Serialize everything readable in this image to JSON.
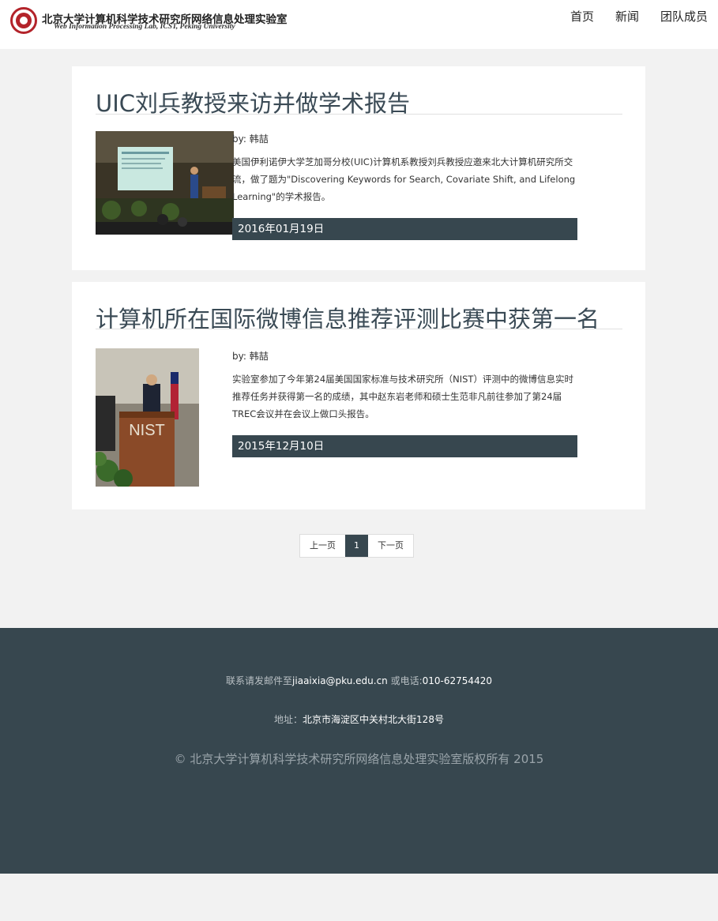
{
  "header": {
    "lab_name_cn": "北京大学计算机科学技术研究所网络信息处理实验室",
    "lab_name_en": "Web Information Processing Lab, ICST, Peking University",
    "nav": [
      "首页",
      "新闻",
      "团队成员"
    ]
  },
  "articles": [
    {
      "title": "UIC刘兵教授来访并做学术报告",
      "author": "by: 韩喆",
      "summary": "美国伊利诺伊大学芝加哥分校(UIC)计算机系教授刘兵教授应邀来北大计算机研究所交流，做了题为\"Discovering Keywords for Search, Covariate Shift, and Lifelong Learning\"的学术报告。",
      "date": "2016年01月19日"
    },
    {
      "title": "计算机所在国际微博信息推荐评测比赛中获第一名",
      "author": "by: 韩喆",
      "summary": "实验室参加了今年第24届美国国家标准与技术研究所（NIST）评测中的微博信息实时推荐任务并获得第一名的成绩，其中赵东岩老师和硕士生范非凡前往参加了第24届TREC会议并在会议上做口头报告。",
      "date": "2015年12月10日"
    }
  ],
  "pagination": {
    "prev": "上一页",
    "current": "1",
    "next": "下一页"
  },
  "footer": {
    "contact_prefix": "联系请发邮件至",
    "email": "jiaaixia@pku.edu.cn",
    "contact_mid": " 或电话:",
    "phone": "010-62754420",
    "address_label": "地址：",
    "address": "北京市海淀区中关村北大街128号",
    "copyright": "© 北京大学计算机科学技术研究所网络信息处理实验室版权所有 2015"
  },
  "colors": {
    "accent": "#37474f",
    "seal": "#b3232a"
  }
}
